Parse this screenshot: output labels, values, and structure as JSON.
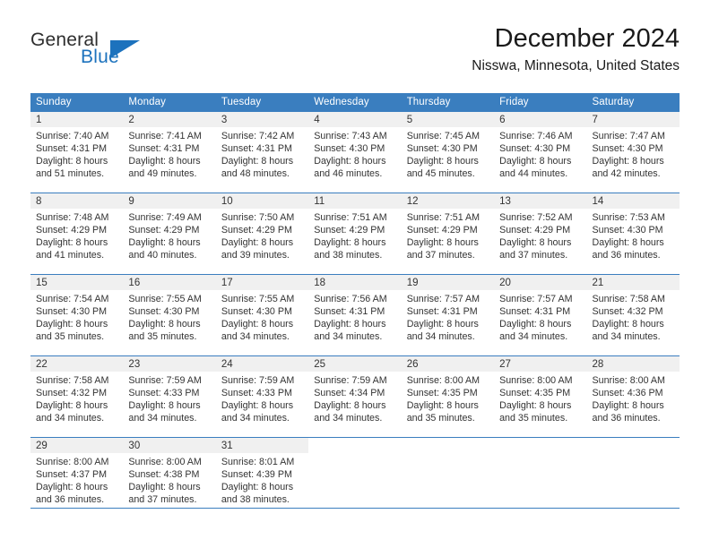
{
  "brand": {
    "name_part1": "General",
    "name_part2": "Blue",
    "logo_icon": "triangle-icon"
  },
  "header": {
    "title": "December 2024",
    "subtitle": "Nisswa, Minnesota, United States"
  },
  "colors": {
    "header_blue": "#3a7ebf",
    "brand_blue": "#1c72bd",
    "daynum_band": "#f0f0f0",
    "text": "#333333"
  },
  "weekday_headers": [
    "Sunday",
    "Monday",
    "Tuesday",
    "Wednesday",
    "Thursday",
    "Friday",
    "Saturday"
  ],
  "weeks": [
    [
      {
        "day": "1",
        "lines": [
          "Sunrise: 7:40 AM",
          "Sunset: 4:31 PM",
          "Daylight: 8 hours",
          "and 51 minutes."
        ]
      },
      {
        "day": "2",
        "lines": [
          "Sunrise: 7:41 AM",
          "Sunset: 4:31 PM",
          "Daylight: 8 hours",
          "and 49 minutes."
        ]
      },
      {
        "day": "3",
        "lines": [
          "Sunrise: 7:42 AM",
          "Sunset: 4:31 PM",
          "Daylight: 8 hours",
          "and 48 minutes."
        ]
      },
      {
        "day": "4",
        "lines": [
          "Sunrise: 7:43 AM",
          "Sunset: 4:30 PM",
          "Daylight: 8 hours",
          "and 46 minutes."
        ]
      },
      {
        "day": "5",
        "lines": [
          "Sunrise: 7:45 AM",
          "Sunset: 4:30 PM",
          "Daylight: 8 hours",
          "and 45 minutes."
        ]
      },
      {
        "day": "6",
        "lines": [
          "Sunrise: 7:46 AM",
          "Sunset: 4:30 PM",
          "Daylight: 8 hours",
          "and 44 minutes."
        ]
      },
      {
        "day": "7",
        "lines": [
          "Sunrise: 7:47 AM",
          "Sunset: 4:30 PM",
          "Daylight: 8 hours",
          "and 42 minutes."
        ]
      }
    ],
    [
      {
        "day": "8",
        "lines": [
          "Sunrise: 7:48 AM",
          "Sunset: 4:29 PM",
          "Daylight: 8 hours",
          "and 41 minutes."
        ]
      },
      {
        "day": "9",
        "lines": [
          "Sunrise: 7:49 AM",
          "Sunset: 4:29 PM",
          "Daylight: 8 hours",
          "and 40 minutes."
        ]
      },
      {
        "day": "10",
        "lines": [
          "Sunrise: 7:50 AM",
          "Sunset: 4:29 PM",
          "Daylight: 8 hours",
          "and 39 minutes."
        ]
      },
      {
        "day": "11",
        "lines": [
          "Sunrise: 7:51 AM",
          "Sunset: 4:29 PM",
          "Daylight: 8 hours",
          "and 38 minutes."
        ]
      },
      {
        "day": "12",
        "lines": [
          "Sunrise: 7:51 AM",
          "Sunset: 4:29 PM",
          "Daylight: 8 hours",
          "and 37 minutes."
        ]
      },
      {
        "day": "13",
        "lines": [
          "Sunrise: 7:52 AM",
          "Sunset: 4:29 PM",
          "Daylight: 8 hours",
          "and 37 minutes."
        ]
      },
      {
        "day": "14",
        "lines": [
          "Sunrise: 7:53 AM",
          "Sunset: 4:30 PM",
          "Daylight: 8 hours",
          "and 36 minutes."
        ]
      }
    ],
    [
      {
        "day": "15",
        "lines": [
          "Sunrise: 7:54 AM",
          "Sunset: 4:30 PM",
          "Daylight: 8 hours",
          "and 35 minutes."
        ]
      },
      {
        "day": "16",
        "lines": [
          "Sunrise: 7:55 AM",
          "Sunset: 4:30 PM",
          "Daylight: 8 hours",
          "and 35 minutes."
        ]
      },
      {
        "day": "17",
        "lines": [
          "Sunrise: 7:55 AM",
          "Sunset: 4:30 PM",
          "Daylight: 8 hours",
          "and 34 minutes."
        ]
      },
      {
        "day": "18",
        "lines": [
          "Sunrise: 7:56 AM",
          "Sunset: 4:31 PM",
          "Daylight: 8 hours",
          "and 34 minutes."
        ]
      },
      {
        "day": "19",
        "lines": [
          "Sunrise: 7:57 AM",
          "Sunset: 4:31 PM",
          "Daylight: 8 hours",
          "and 34 minutes."
        ]
      },
      {
        "day": "20",
        "lines": [
          "Sunrise: 7:57 AM",
          "Sunset: 4:31 PM",
          "Daylight: 8 hours",
          "and 34 minutes."
        ]
      },
      {
        "day": "21",
        "lines": [
          "Sunrise: 7:58 AM",
          "Sunset: 4:32 PM",
          "Daylight: 8 hours",
          "and 34 minutes."
        ]
      }
    ],
    [
      {
        "day": "22",
        "lines": [
          "Sunrise: 7:58 AM",
          "Sunset: 4:32 PM",
          "Daylight: 8 hours",
          "and 34 minutes."
        ]
      },
      {
        "day": "23",
        "lines": [
          "Sunrise: 7:59 AM",
          "Sunset: 4:33 PM",
          "Daylight: 8 hours",
          "and 34 minutes."
        ]
      },
      {
        "day": "24",
        "lines": [
          "Sunrise: 7:59 AM",
          "Sunset: 4:33 PM",
          "Daylight: 8 hours",
          "and 34 minutes."
        ]
      },
      {
        "day": "25",
        "lines": [
          "Sunrise: 7:59 AM",
          "Sunset: 4:34 PM",
          "Daylight: 8 hours",
          "and 34 minutes."
        ]
      },
      {
        "day": "26",
        "lines": [
          "Sunrise: 8:00 AM",
          "Sunset: 4:35 PM",
          "Daylight: 8 hours",
          "and 35 minutes."
        ]
      },
      {
        "day": "27",
        "lines": [
          "Sunrise: 8:00 AM",
          "Sunset: 4:35 PM",
          "Daylight: 8 hours",
          "and 35 minutes."
        ]
      },
      {
        "day": "28",
        "lines": [
          "Sunrise: 8:00 AM",
          "Sunset: 4:36 PM",
          "Daylight: 8 hours",
          "and 36 minutes."
        ]
      }
    ],
    [
      {
        "day": "29",
        "lines": [
          "Sunrise: 8:00 AM",
          "Sunset: 4:37 PM",
          "Daylight: 8 hours",
          "and 36 minutes."
        ]
      },
      {
        "day": "30",
        "lines": [
          "Sunrise: 8:00 AM",
          "Sunset: 4:38 PM",
          "Daylight: 8 hours",
          "and 37 minutes."
        ]
      },
      {
        "day": "31",
        "lines": [
          "Sunrise: 8:01 AM",
          "Sunset: 4:39 PM",
          "Daylight: 8 hours",
          "and 38 minutes."
        ]
      },
      {
        "day": "",
        "lines": []
      },
      {
        "day": "",
        "lines": []
      },
      {
        "day": "",
        "lines": []
      },
      {
        "day": "",
        "lines": []
      }
    ]
  ]
}
